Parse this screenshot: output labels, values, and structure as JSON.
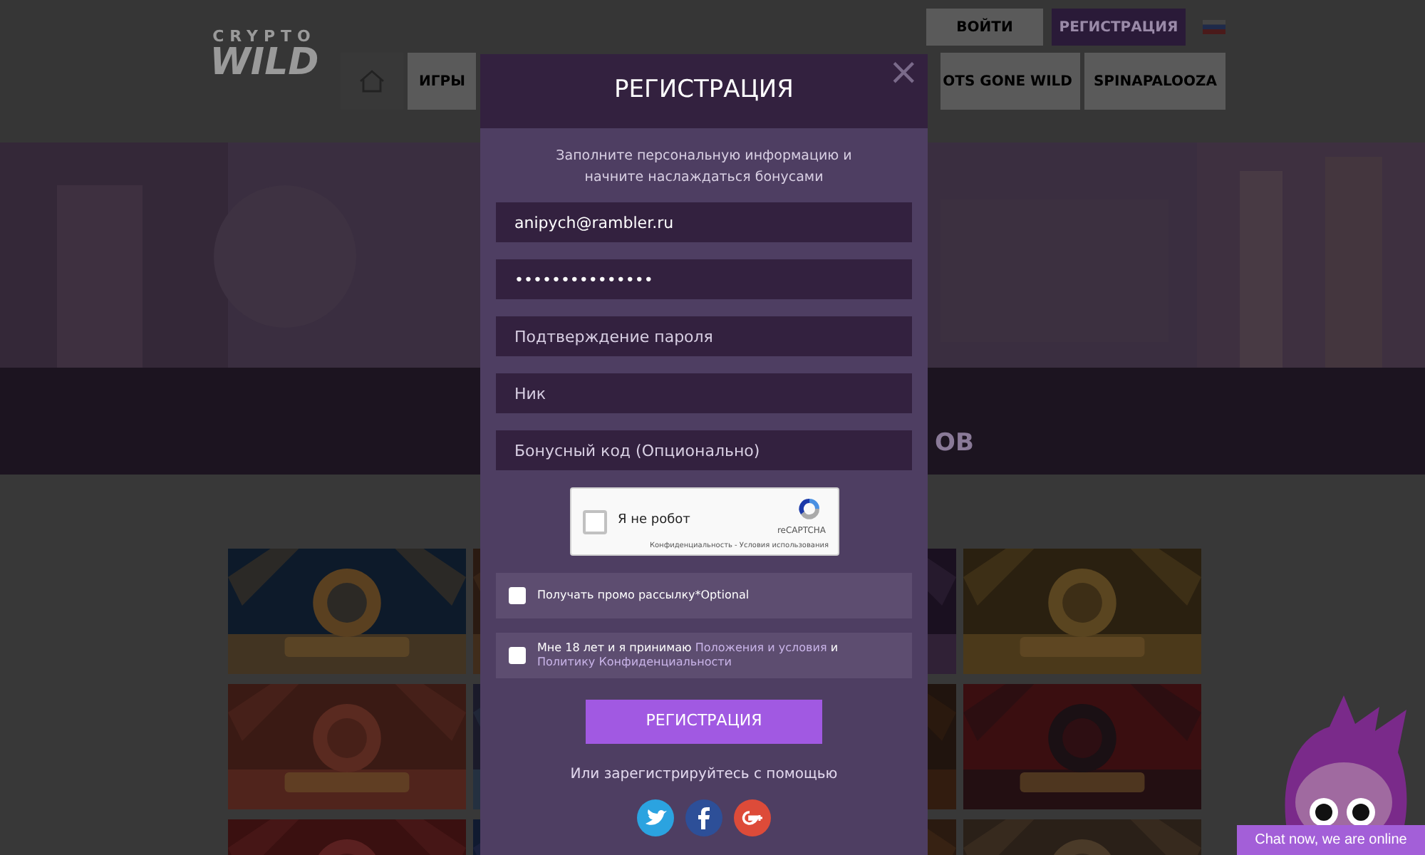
{
  "header": {
    "logo": {
      "top": "CRYPTO",
      "main": "WILD"
    },
    "login_button": "ВОЙТИ",
    "register_button": "РЕГИСТРАЦИЯ",
    "nav": [
      {
        "label": "ИГРЫ"
      },
      {
        "label": "OTS GONE WILD"
      },
      {
        "label": "SPINAPALOOZA"
      }
    ]
  },
  "section_heading": "ОВ",
  "modal": {
    "title": "РЕГИСТРАЦИЯ",
    "close": "×",
    "intro": "Заполните персональную информацию и начните наслаждаться бонусами",
    "fields": [
      {
        "value": "anipych@rambler.ru"
      },
      {
        "value": "•••••••••••••••"
      },
      {
        "placeholder": "Подтверждение пароля"
      },
      {
        "placeholder": "Ник"
      },
      {
        "placeholder": "Бонусный код (Опционально)"
      }
    ],
    "captcha": {
      "label": "Я не робот",
      "checked": false,
      "brand": "reCAPTCHA",
      "links": "Конфиденциальность - Условия использования"
    },
    "checkboxes": [
      {
        "checked": false,
        "parts": [
          {
            "kind": "text",
            "text": "Получать промо рассылку*Optional"
          }
        ]
      },
      {
        "checked": false,
        "parts": [
          {
            "kind": "text",
            "text": "Мне 18 лет и я принимаю"
          },
          {
            "kind": "link",
            "text": "Положения и условия"
          },
          {
            "kind": "text",
            "text": "и"
          },
          {
            "kind": "link",
            "text": "Политику Конфиденциальности"
          }
        ]
      }
    ],
    "submit": "РЕГИСТРАЦИЯ",
    "social_caption": "Или зарегистрируйтесь с помощью"
  },
  "chat": {
    "label": "Chat now, we are online"
  }
}
